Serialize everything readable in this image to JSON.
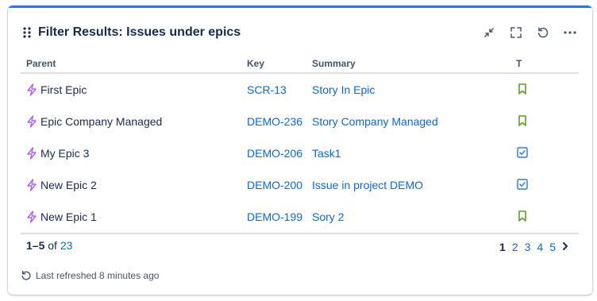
{
  "gadget": {
    "title": "Filter Results: Issues under epics",
    "actions": [
      {
        "name": "minimize-icon"
      },
      {
        "name": "fullscreen-icon"
      },
      {
        "name": "refresh-icon"
      },
      {
        "name": "more-icon"
      }
    ]
  },
  "table": {
    "columns": [
      "Parent",
      "Key",
      "Summary",
      "T"
    ],
    "rows": [
      {
        "parent": "First Epic",
        "key": "SCR-13",
        "summary": "Story In Epic",
        "type": "story"
      },
      {
        "parent": "Epic Company Managed",
        "key": "DEMO-236",
        "summary": "Story Company Managed",
        "type": "story"
      },
      {
        "parent": "My Epic 3",
        "key": "DEMO-206",
        "summary": "Task1",
        "type": "task"
      },
      {
        "parent": "New Epic 2",
        "key": "DEMO-200",
        "summary": "Issue in project DEMO",
        "type": "task"
      },
      {
        "parent": "New Epic 1",
        "key": "DEMO-199",
        "summary": "Sory 2",
        "type": "story"
      }
    ]
  },
  "footer": {
    "range": "1–5",
    "of": "of",
    "total": "23",
    "pages": [
      "1",
      "2",
      "3",
      "4",
      "5"
    ],
    "current_page": "1",
    "refresh_text": "Last refreshed 8 minutes ago"
  },
  "colors": {
    "accent": "#1d7afc",
    "link": "#0c66e4",
    "epic": "#b25ef3",
    "story": "#5e9d2a",
    "task": "#2f7fe8"
  }
}
